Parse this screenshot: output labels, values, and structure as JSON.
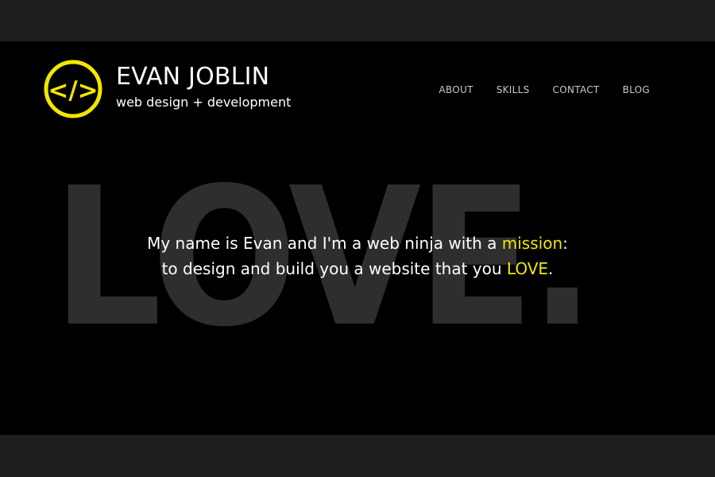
{
  "colors": {
    "accent": "#f2e600",
    "background": "#000000",
    "frame": "#1f1f1f",
    "background_word": "#2e2e2e",
    "text": "#ffffff",
    "nav_text": "#c8c8c8"
  },
  "logo": {
    "icon": "code-brackets-icon",
    "symbol": "</>"
  },
  "brand": {
    "name": "EVAN JOBLIN",
    "tagline": "web design + development"
  },
  "nav": {
    "items": [
      {
        "label": "ABOUT"
      },
      {
        "label": "SKILLS"
      },
      {
        "label": "CONTACT"
      },
      {
        "label": "BLOG"
      }
    ]
  },
  "hero": {
    "background_word": "LOVE.",
    "line1_before": "My name is Evan and I'm a web ninja with a ",
    "line1_highlight": "mission",
    "line1_after": ":",
    "line2_before": "to design and build you a website that you ",
    "line2_highlight": "LOVE",
    "line2_after": "."
  }
}
